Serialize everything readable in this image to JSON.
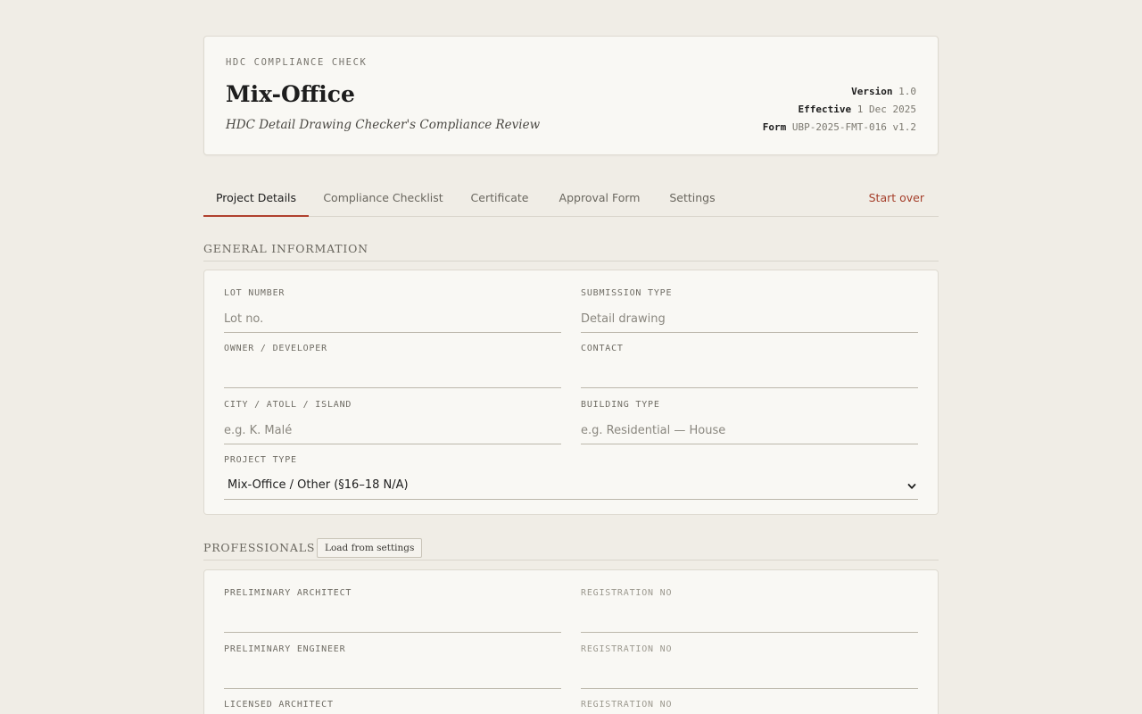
{
  "header": {
    "kicker": "HDC COMPLIANCE CHECK",
    "title": "Mix-Office",
    "subtitle": "HDC Detail Drawing Checker's Compliance Review",
    "meta": [
      {
        "key": "Version",
        "value": "1.0"
      },
      {
        "key": "Effective",
        "value": "1 Dec 2025"
      },
      {
        "key": "Form",
        "value": "UBP-2025-FMT-016 v1.2"
      }
    ]
  },
  "tabs": [
    {
      "label": "Project Details",
      "active": true
    },
    {
      "label": "Compliance Checklist",
      "active": false
    },
    {
      "label": "Certificate",
      "active": false
    },
    {
      "label": "Approval Form",
      "active": false
    },
    {
      "label": "Settings",
      "active": false
    }
  ],
  "start_over_label": "Start over",
  "general": {
    "title": "GENERAL INFORMATION",
    "fields": {
      "lot_number": {
        "label": "LOT NUMBER",
        "placeholder": "Lot no.",
        "value": ""
      },
      "submission_type": {
        "label": "SUBMISSION TYPE",
        "placeholder": "Detail drawing",
        "value": ""
      },
      "owner": {
        "label": "OWNER / DEVELOPER",
        "placeholder": "",
        "value": ""
      },
      "contact": {
        "label": "CONTACT",
        "placeholder": "",
        "value": ""
      },
      "city": {
        "label": "CITY / ATOLL / ISLAND",
        "placeholder": "e.g. K. Malé",
        "value": ""
      },
      "building_type": {
        "label": "BUILDING TYPE",
        "placeholder": "e.g. Residential — House",
        "value": ""
      },
      "project_type": {
        "label": "PROJECT TYPE",
        "value": "Mix-Office / Other (§16–18 N/A)"
      }
    }
  },
  "professionals": {
    "title": "PROFESSIONALS",
    "load_button": "Load from settings",
    "fields": {
      "prelim_architect": {
        "label": "PRELIMINARY ARCHITECT",
        "value": ""
      },
      "prelim_architect_reg": {
        "label": "REGISTRATION NO",
        "value": ""
      },
      "prelim_engineer": {
        "label": "PRELIMINARY ENGINEER",
        "value": ""
      },
      "prelim_engineer_reg": {
        "label": "REGISTRATION NO",
        "value": ""
      },
      "licensed_architect": {
        "label": "LICENSED ARCHITECT",
        "value": ""
      },
      "licensed_architect_reg": {
        "label": "REGISTRATION NO",
        "value": ""
      }
    }
  },
  "icons": {
    "select_chevron": "chevron-down-icon"
  }
}
